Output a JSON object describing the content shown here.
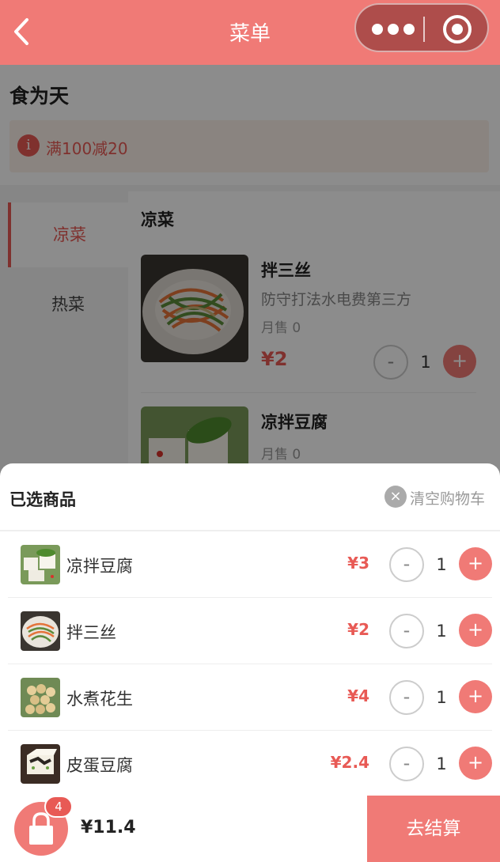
{
  "nav": {
    "title": "菜单",
    "back_icon": "chevron-left-icon",
    "more_icon": "more-dots-icon",
    "close_icon": "target-circle-icon"
  },
  "shop": {
    "name": "食为天",
    "promo_icon": "info-icon",
    "promo_icon_glyph": "i",
    "promo": "满100减20"
  },
  "sidebar": {
    "items": [
      {
        "label": "凉菜",
        "active": true
      },
      {
        "label": "热菜",
        "active": false
      }
    ]
  },
  "menu": {
    "section": "凉菜",
    "foods": [
      {
        "name": "拌三丝",
        "desc": "防守打法水电费第三方",
        "sales": "月售 0",
        "price": "¥2",
        "qty": "1"
      },
      {
        "name": "凉拌豆腐",
        "sales": "月售 0"
      }
    ]
  },
  "cart": {
    "title": "已选商品",
    "clear_icon_glyph": "×",
    "clear_label": "清空购物车",
    "minus": "-",
    "plus": "+",
    "items": [
      {
        "name": "凉拌豆腐",
        "price": "¥3",
        "qty": "1"
      },
      {
        "name": "拌三丝",
        "price": "¥2",
        "qty": "1"
      },
      {
        "name": "水煮花生",
        "price": "¥4",
        "qty": "1"
      },
      {
        "name": "皮蛋豆腐",
        "price": "¥2.4",
        "qty": "1"
      }
    ]
  },
  "bottom": {
    "badge": "4",
    "total": "¥11.4",
    "checkout": "去结算",
    "cart_icon": "shopping-bag-icon"
  },
  "colors": {
    "brand": "#f07a76",
    "accent": "#e85a55"
  }
}
